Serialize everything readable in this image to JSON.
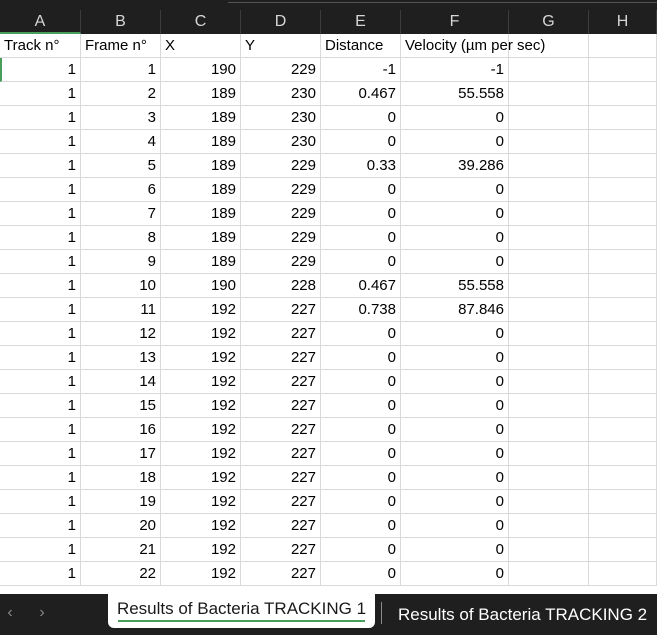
{
  "columns": [
    "A",
    "B",
    "C",
    "D",
    "E",
    "F",
    "G",
    "H"
  ],
  "headers": [
    "Track n°",
    "Frame n°",
    "X",
    "Y",
    "Distance",
    "Velocity (µm per sec)",
    "",
    ""
  ],
  "rows": [
    [
      "1",
      "1",
      "190",
      "229",
      "-1",
      "-1"
    ],
    [
      "1",
      "2",
      "189",
      "230",
      "0.467",
      "55.558"
    ],
    [
      "1",
      "3",
      "189",
      "230",
      "0",
      "0"
    ],
    [
      "1",
      "4",
      "189",
      "230",
      "0",
      "0"
    ],
    [
      "1",
      "5",
      "189",
      "229",
      "0.33",
      "39.286"
    ],
    [
      "1",
      "6",
      "189",
      "229",
      "0",
      "0"
    ],
    [
      "1",
      "7",
      "189",
      "229",
      "0",
      "0"
    ],
    [
      "1",
      "8",
      "189",
      "229",
      "0",
      "0"
    ],
    [
      "1",
      "9",
      "189",
      "229",
      "0",
      "0"
    ],
    [
      "1",
      "10",
      "190",
      "228",
      "0.467",
      "55.558"
    ],
    [
      "1",
      "11",
      "192",
      "227",
      "0.738",
      "87.846"
    ],
    [
      "1",
      "12",
      "192",
      "227",
      "0",
      "0"
    ],
    [
      "1",
      "13",
      "192",
      "227",
      "0",
      "0"
    ],
    [
      "1",
      "14",
      "192",
      "227",
      "0",
      "0"
    ],
    [
      "1",
      "15",
      "192",
      "227",
      "0",
      "0"
    ],
    [
      "1",
      "16",
      "192",
      "227",
      "0",
      "0"
    ],
    [
      "1",
      "17",
      "192",
      "227",
      "0",
      "0"
    ],
    [
      "1",
      "18",
      "192",
      "227",
      "0",
      "0"
    ],
    [
      "1",
      "19",
      "192",
      "227",
      "0",
      "0"
    ],
    [
      "1",
      "20",
      "192",
      "227",
      "0",
      "0"
    ],
    [
      "1",
      "21",
      "192",
      "227",
      "0",
      "0"
    ],
    [
      "1",
      "22",
      "192",
      "227",
      "0",
      "0"
    ]
  ],
  "tabs": {
    "prev": "‹",
    "next": "›",
    "active": "Results of Bacteria TRACKING 1",
    "inactive": "Results of Bacteria TRACKING 2"
  },
  "colors": {
    "accent": "#4a9e5c",
    "gridline": "#d9d9d9",
    "chrome": "#1f1f1f"
  }
}
